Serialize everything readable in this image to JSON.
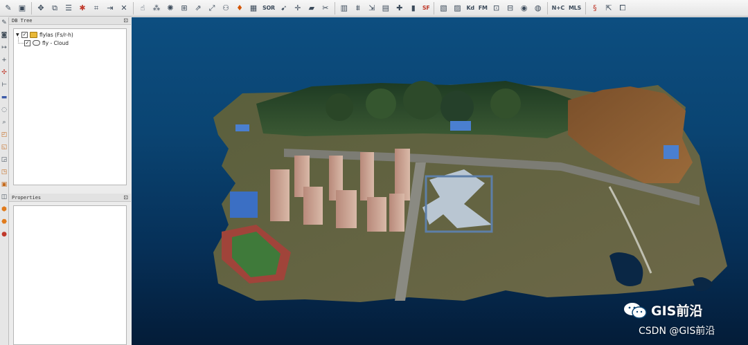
{
  "toolbar": {
    "icons": [
      "open-file-icon",
      "save-icon",
      "translate-icon",
      "clone-icon",
      "list-icon",
      "delete-red-icon",
      "crop-icon",
      "merge-icon",
      "close-x-icon",
      "point-pick-icon",
      "sample-icon",
      "subsample-icon",
      "noise-icon",
      "normals-icon",
      "scale-icon",
      "colorize-icon",
      "sor-icon",
      "arrow-icon",
      "move-icon",
      "plane-icon",
      "segment-icon",
      "histogram-icon",
      "stats-icon",
      "filter-icon",
      "grid-icon",
      "plus-icon",
      "compute-icon",
      "sf-icon",
      "octree-icon",
      "density-icon",
      "roughness-icon",
      "fm-icon",
      "registration-icon",
      "disc-icon",
      "sphere-icon",
      "globe-icon",
      "n-c-icon",
      "mls-icon",
      "sf-curve-icon",
      "export-icon",
      "script-icon"
    ],
    "labels": {
      "sor": "SOR",
      "sf": "SF",
      "kd": "Kd",
      "fm": "FM",
      "nc": "N+C",
      "mls": "MLS"
    }
  },
  "vtoolbar": {
    "icons": [
      "pencil-icon",
      "camera-icon",
      "ruler-icon",
      "cross-icon",
      "point-icon",
      "axis-icon",
      "plane-view-icon",
      "circle-icon",
      "zoom-icon",
      "cube-top-icon",
      "cube-front-icon",
      "cube-left-icon",
      "cube-back-icon",
      "cube-right-icon",
      "cube-bottom-icon",
      "iso-view-icon",
      "iso-view2-icon",
      "palette-icon"
    ]
  },
  "dbtree": {
    "title": "DB Tree",
    "float_glyph": "⊡",
    "items": [
      {
        "label": "flylas (Fs/r-h)",
        "checked": true
      },
      {
        "label": "fly - Cloud",
        "checked": true
      }
    ]
  },
  "properties": {
    "title": "Properties",
    "float_glyph": "⊡"
  },
  "viewport": {
    "name": "3D point cloud view"
  },
  "watermark": {
    "main": "GIS前沿",
    "sub": "CSDN @GIS前沿"
  },
  "colors": {
    "sky_top": "#0d4e80",
    "sky_bottom": "#041c38"
  }
}
